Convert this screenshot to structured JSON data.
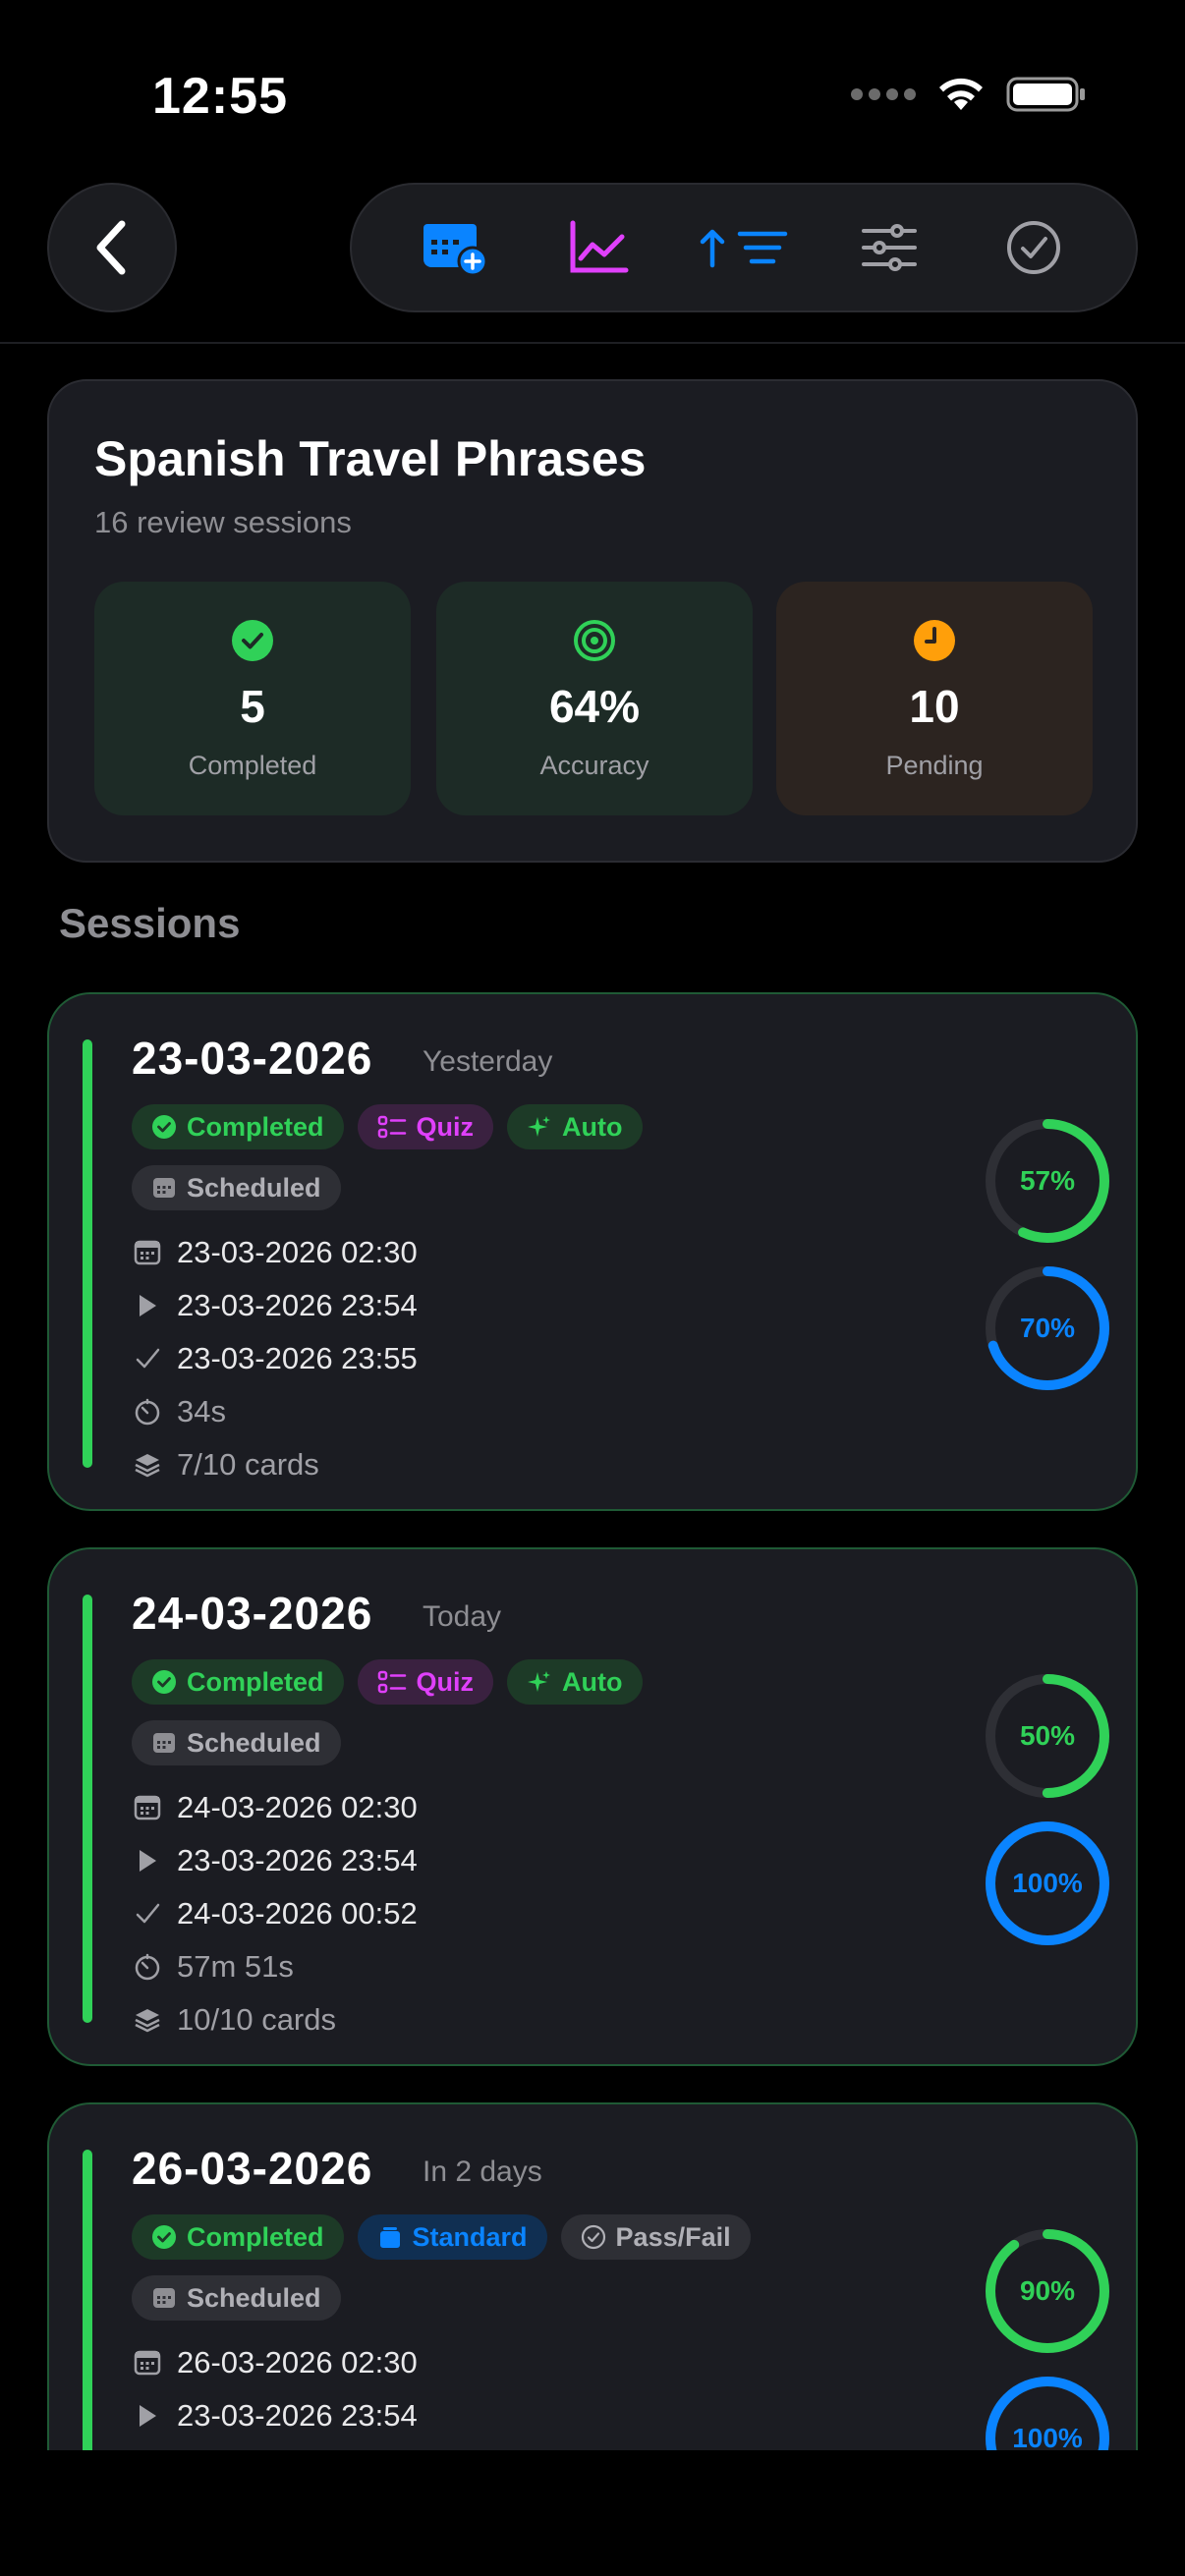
{
  "status_bar": {
    "time": "12:55"
  },
  "toolbar": {
    "buttons": [
      "calendar-add-icon",
      "chart-line-icon",
      "sort-icon",
      "sliders-icon",
      "checkmark-circle-icon"
    ]
  },
  "summary": {
    "title": "Spanish Travel Phrases",
    "subtitle": "16 review sessions",
    "stats": [
      {
        "value": "5",
        "label": "Completed",
        "color": "#30d158"
      },
      {
        "value": "64%",
        "label": "Accuracy",
        "color": "#30d158"
      },
      {
        "value": "10",
        "label": "Pending",
        "color": "#ff9f0a"
      }
    ]
  },
  "sessions_title": "Sessions",
  "sessions": [
    {
      "date": "23-03-2026",
      "relative": "Yesterday",
      "chips": [
        "Completed",
        "Quiz",
        "Auto"
      ],
      "chip2": "Scheduled",
      "scheduled": "23-03-2026 02:30",
      "started": "23-03-2026 23:54",
      "completed": "23-03-2026 23:55",
      "duration": "34s",
      "cards": "7/10 cards",
      "ring1": {
        "label": "57%",
        "value": 0.57
      },
      "ring2": {
        "label": "70%",
        "value": 0.7
      }
    },
    {
      "date": "24-03-2026",
      "relative": "Today",
      "chips": [
        "Completed",
        "Quiz",
        "Auto"
      ],
      "chip2": "Scheduled",
      "scheduled": "24-03-2026 02:30",
      "started": "23-03-2026 23:54",
      "completed": "24-03-2026 00:52",
      "duration": "57m 51s",
      "cards": "10/10 cards",
      "ring1": {
        "label": "50%",
        "value": 0.5
      },
      "ring2": {
        "label": "100%",
        "value": 1.0
      }
    },
    {
      "date": "26-03-2026",
      "relative": "In 2 days",
      "chips": [
        "Completed",
        "Standard",
        "Pass/Fail"
      ],
      "chip2": "Scheduled",
      "scheduled": "26-03-2026 02:30",
      "started": "23-03-2026 23:54",
      "ring1": {
        "label": "90%",
        "value": 0.9
      },
      "ring2": {
        "label": "100%",
        "value": 1.0
      }
    }
  ],
  "colors": {
    "green": "#30d158",
    "blue": "#0a84ff",
    "purple": "#e040fb",
    "orange": "#ff9f0a"
  }
}
